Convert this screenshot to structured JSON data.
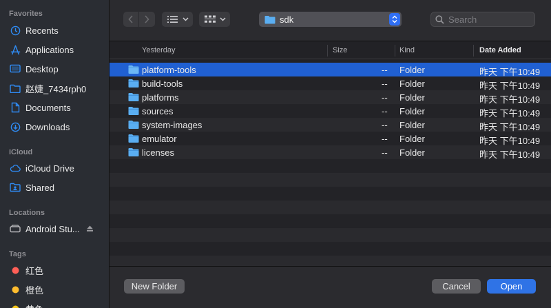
{
  "sidebar": {
    "sections": {
      "favorites": "Favorites",
      "icloud": "iCloud",
      "locations": "Locations",
      "tags": "Tags"
    },
    "favorites": [
      {
        "label": "Recents",
        "icon": "clock-icon"
      },
      {
        "label": "Applications",
        "icon": "applications-icon"
      },
      {
        "label": "Desktop",
        "icon": "desktop-icon"
      },
      {
        "label": "赵婕_7434rph0",
        "icon": "folder-icon"
      },
      {
        "label": "Documents",
        "icon": "document-icon"
      },
      {
        "label": "Downloads",
        "icon": "download-icon"
      }
    ],
    "icloud": [
      {
        "label": "iCloud Drive",
        "icon": "cloud-icon"
      },
      {
        "label": "Shared",
        "icon": "shared-folder-icon"
      }
    ],
    "locations": [
      {
        "label": "Android Stu...",
        "icon": "disk-icon"
      }
    ],
    "tags": [
      {
        "label": "红色",
        "color": "#ff5f57"
      },
      {
        "label": "橙色",
        "color": "#febc2e"
      },
      {
        "label": "黄色",
        "color": "#f5c518"
      }
    ]
  },
  "toolbar": {
    "path": "sdk",
    "search_placeholder": "Search"
  },
  "columns": {
    "name": "Yesterday",
    "size": "Size",
    "kind": "Kind",
    "date": "Date Added"
  },
  "files": [
    {
      "name": "platform-tools",
      "size": "--",
      "kind": "Folder",
      "date": "昨天 下午10:49",
      "selected": true
    },
    {
      "name": "build-tools",
      "size": "--",
      "kind": "Folder",
      "date": "昨天 下午10:49"
    },
    {
      "name": "platforms",
      "size": "--",
      "kind": "Folder",
      "date": "昨天 下午10:49"
    },
    {
      "name": "sources",
      "size": "--",
      "kind": "Folder",
      "date": "昨天 下午10:49"
    },
    {
      "name": "system-images",
      "size": "--",
      "kind": "Folder",
      "date": "昨天 下午10:49"
    },
    {
      "name": "emulator",
      "size": "--",
      "kind": "Folder",
      "date": "昨天 下午10:49"
    },
    {
      "name": "licenses",
      "size": "--",
      "kind": "Folder",
      "date": "昨天 下午10:49"
    }
  ],
  "buttons": {
    "new_folder": "New Folder",
    "cancel": "Cancel",
    "open": "Open"
  },
  "colors": {
    "accent": "#2f73e6",
    "selection": "#2060d2",
    "folder": "#5aaef2"
  }
}
